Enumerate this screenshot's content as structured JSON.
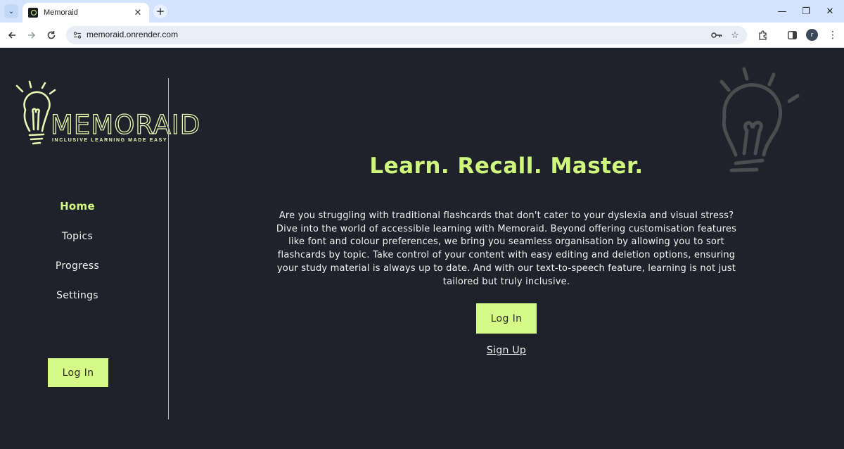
{
  "browser": {
    "tab_title": "Memoraid",
    "tab_close": "✕",
    "new_tab": "+",
    "url": "memoraid.onrender.com",
    "profile_initial": "r",
    "window_controls": {
      "minimize": "—",
      "restore": "❐",
      "close": "✕"
    }
  },
  "logo": {
    "wordmark": "MEMORAID",
    "tagline": "INCLUSIVE LEARNING MADE EASY"
  },
  "sidebar": {
    "items": [
      {
        "label": "Home",
        "active": true
      },
      {
        "label": "Topics",
        "active": false
      },
      {
        "label": "Progress",
        "active": false
      },
      {
        "label": "Settings",
        "active": false
      }
    ],
    "login_label": "Log In"
  },
  "main": {
    "headline": "Learn. Recall. Master.",
    "intro": "Are you struggling with traditional flashcards that don't cater to your dyslexia and visual stress? Dive into the world of accessible learning with Memoraid. Beyond offering customisation features like font and colour preferences, we bring you seamless organisation by allowing you to sort flashcards by topic. Take control of your content with easy editing and deletion options, ensuring your study material is always up to date. And with our text-to-speech feature, learning is not just tailored but truly inclusive.",
    "login_label": "Log In",
    "signup_label": "Sign Up"
  },
  "colors": {
    "background": "#20222b",
    "accent": "#d6fa88",
    "headline": "#cff77e",
    "text": "#f3f3f3"
  },
  "icons": [
    "tab-search-icon",
    "favicon-icon",
    "back-arrow-icon",
    "forward-arrow-icon",
    "reload-icon",
    "site-info-icon",
    "key-icon",
    "star-icon",
    "extensions-icon",
    "side-panel-icon",
    "kebab-menu-icon",
    "lightbulb-icon"
  ]
}
